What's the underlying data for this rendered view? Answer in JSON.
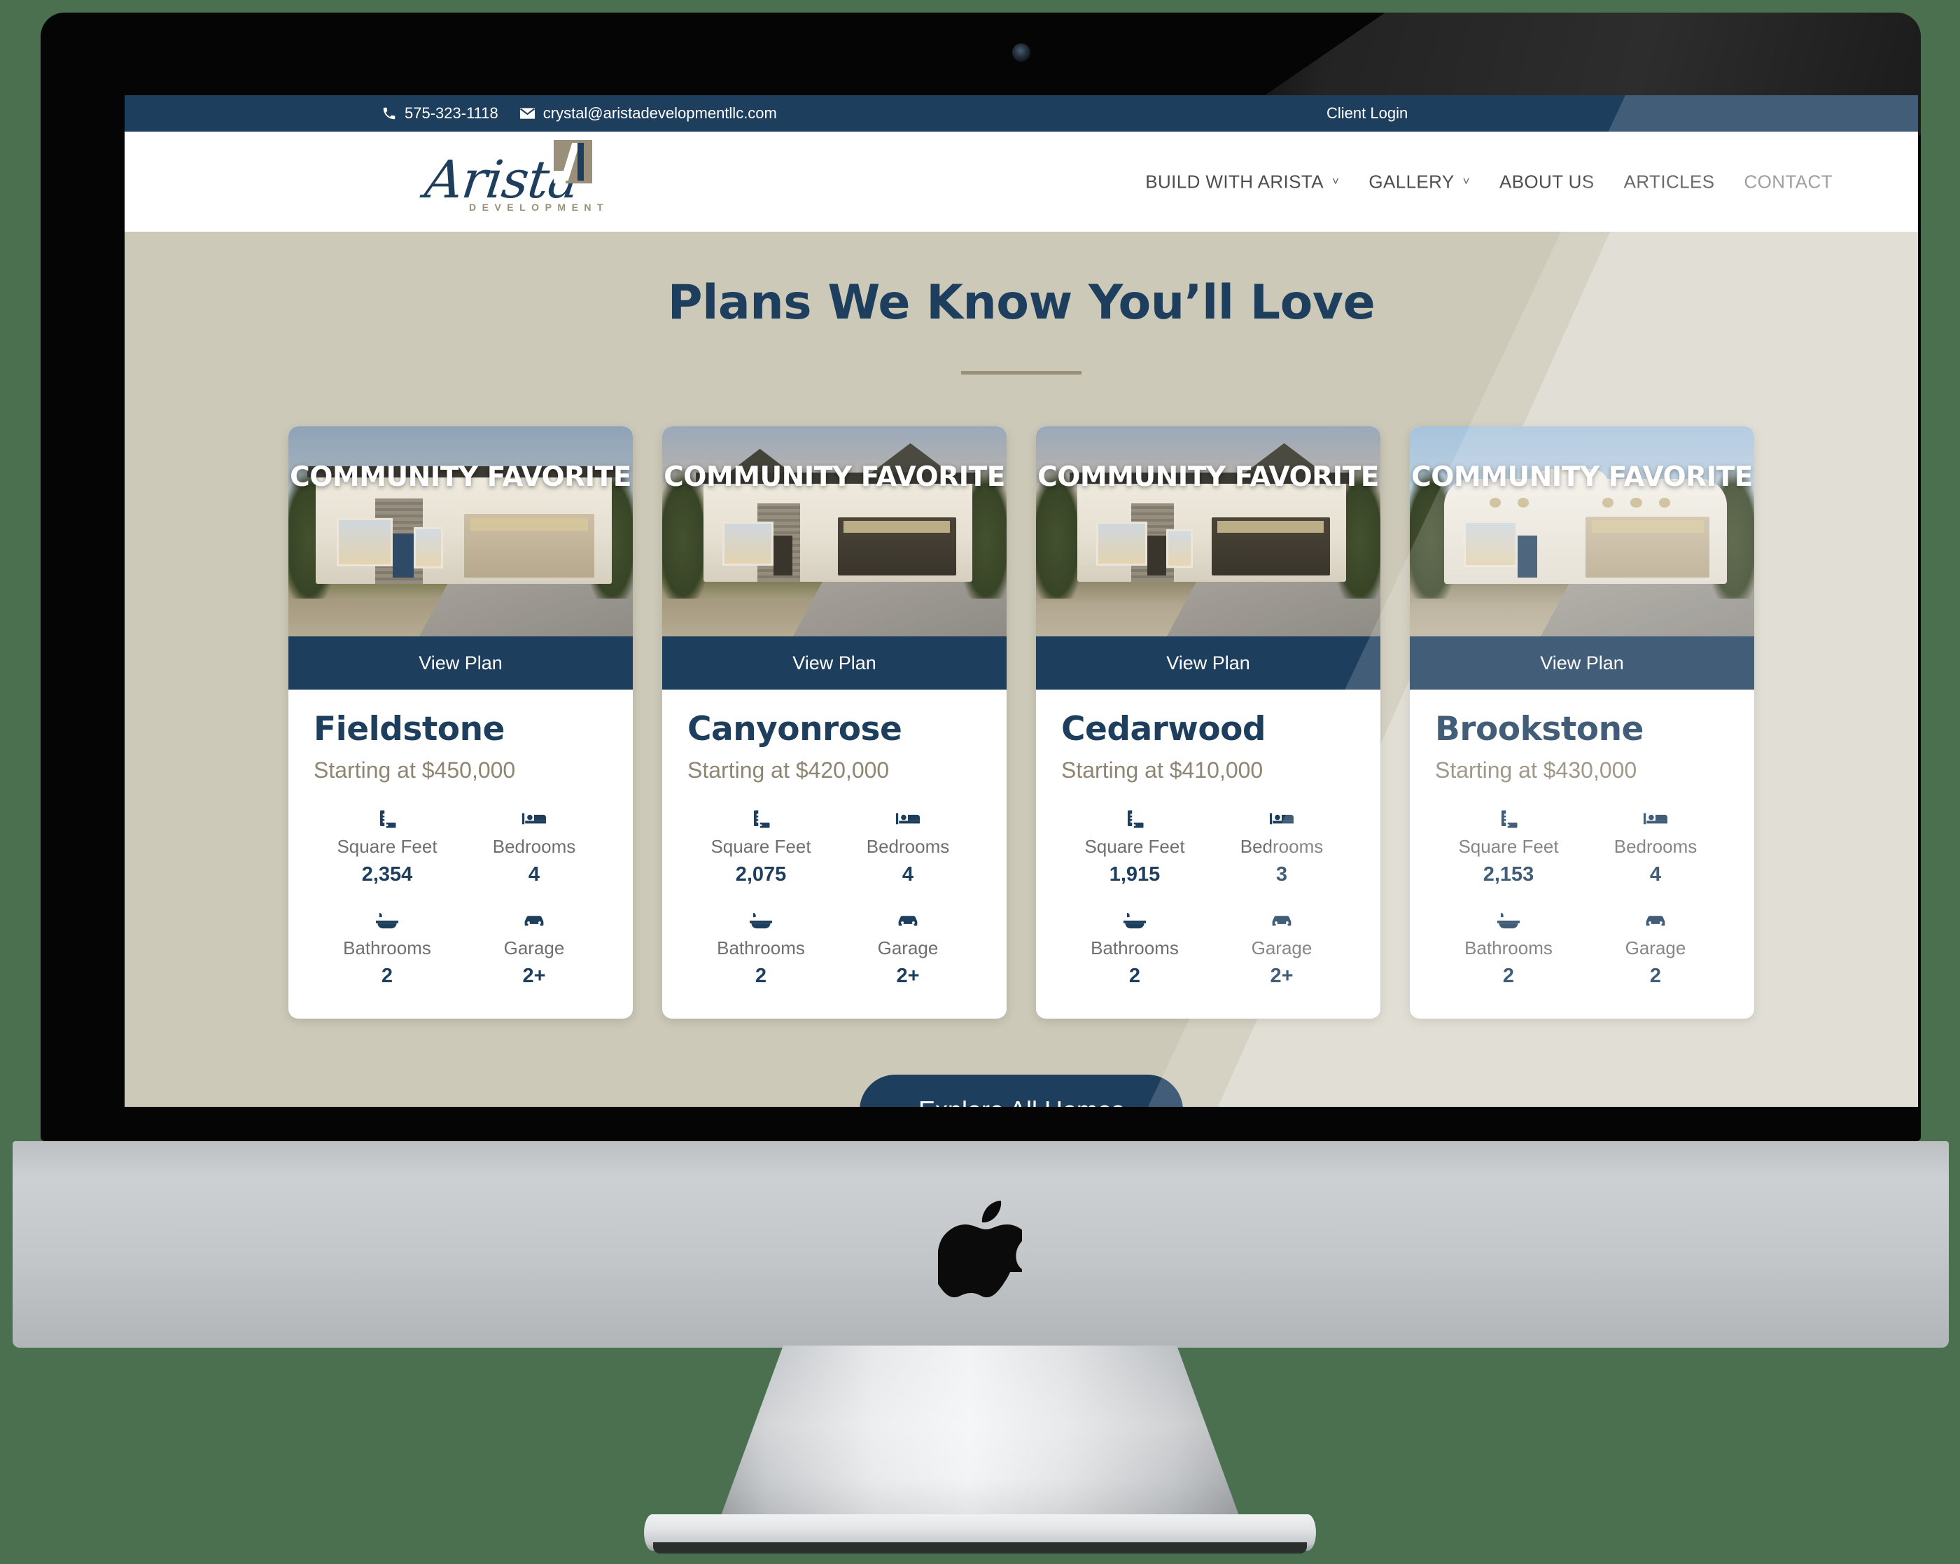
{
  "topbar": {
    "phone": "575-323-1118",
    "email": "crystal@aristadevelopmentllc.com",
    "client_login": "Client Login",
    "bg_color": "#1e3e5e"
  },
  "logo": {
    "script": "Arista",
    "subtitle": "DEVELOPMENT"
  },
  "nav": {
    "items": [
      {
        "label": "BUILD WITH ARISTA",
        "caret": "˅"
      },
      {
        "label": "GALLERY",
        "caret": "˅"
      },
      {
        "label": "ABOUT US",
        "caret": ""
      },
      {
        "label": "ARTICLES",
        "caret": ""
      },
      {
        "label": "CONTACT",
        "caret": ""
      }
    ]
  },
  "section": {
    "title": "Plans We Know You’ll Love",
    "explore_label": "Explore All Homes",
    "accent_color": "#1e3e5e",
    "bg_color": "#cdc9b8",
    "price_color": "#8e8673"
  },
  "spec_labels": {
    "square_feet": "Square Feet",
    "bedrooms": "Bedrooms",
    "bathrooms": "Bathrooms",
    "garage": "Garage"
  },
  "cards": [
    {
      "badge": "COMMUNITY FAVORITE",
      "cta": "View Plan",
      "name": "Fieldstone",
      "price": "Starting at $450,000",
      "square_feet": "2,354",
      "bedrooms": "4",
      "bathrooms": "2",
      "garage": "2+"
    },
    {
      "badge": "COMMUNITY FAVORITE",
      "cta": "View Plan",
      "name": "Canyonrose",
      "price": "Starting at $420,000",
      "square_feet": "2,075",
      "bedrooms": "4",
      "bathrooms": "2",
      "garage": "2+"
    },
    {
      "badge": "COMMUNITY FAVORITE",
      "cta": "View Plan",
      "name": "Cedarwood",
      "price": "Starting at $410,000",
      "square_feet": "1,915",
      "bedrooms": "3",
      "bathrooms": "2",
      "garage": "2+"
    },
    {
      "badge": "COMMUNITY FAVORITE",
      "cta": "View Plan",
      "name": "Brookstone",
      "price": "Starting at $430,000",
      "square_feet": "2,153",
      "bedrooms": "4",
      "bathrooms": "2",
      "garage": "2"
    }
  ],
  "device": {
    "brand_icon": "apple-logo",
    "bezel_color": "#050505",
    "background_color": "#4a7050"
  }
}
